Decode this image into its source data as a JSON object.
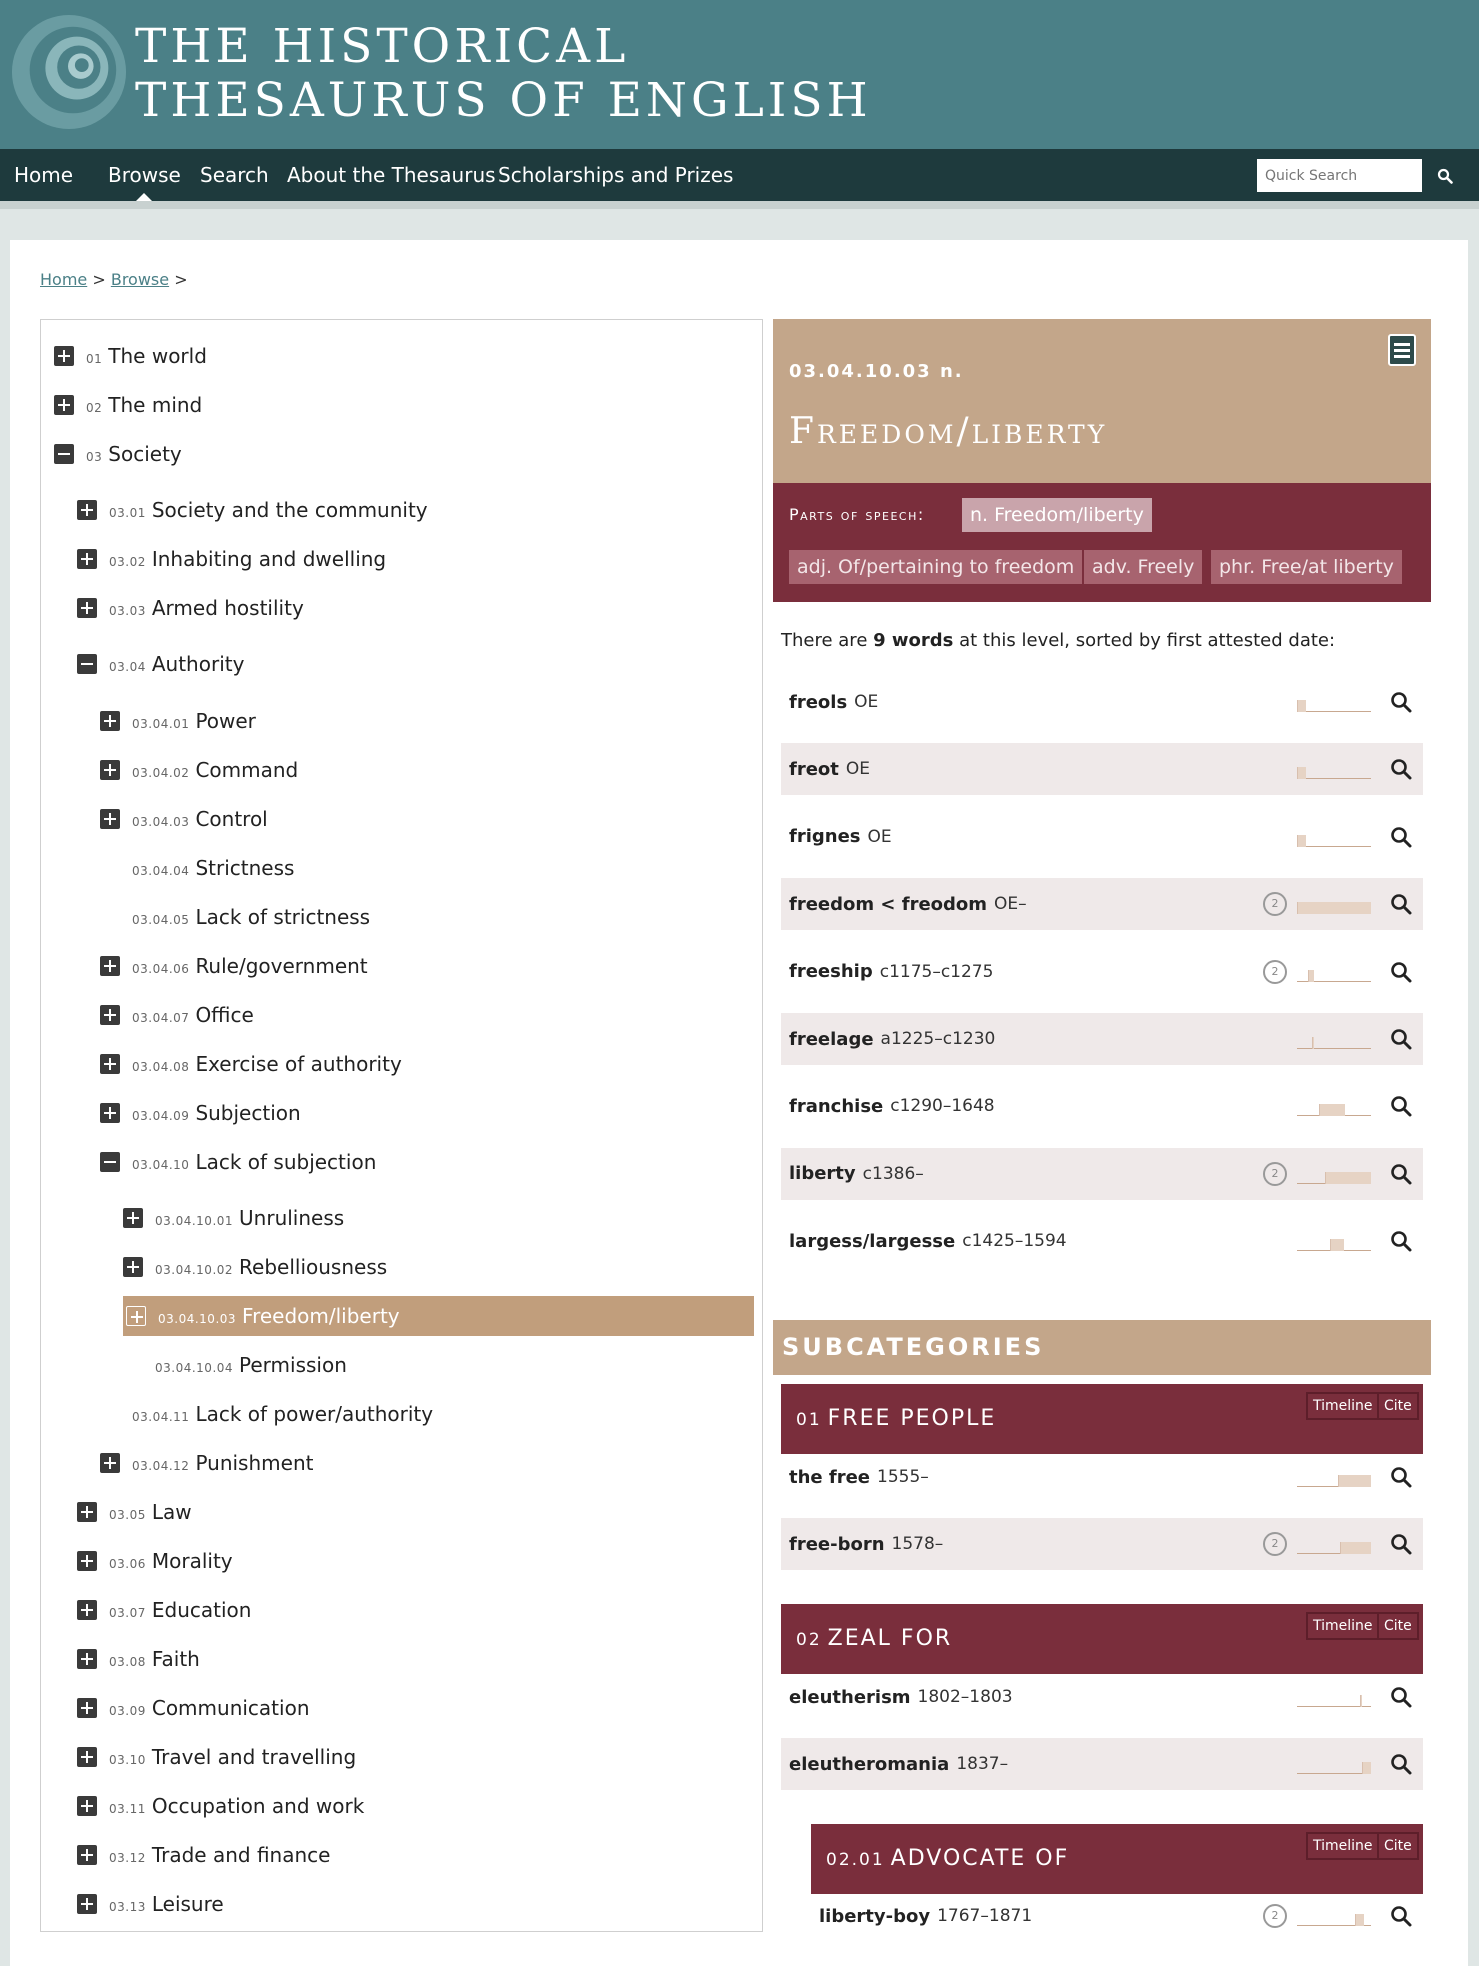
{
  "site": {
    "title_line1": "THE HISTORICAL",
    "title_line2": "THESAURUS OF ENGLISH"
  },
  "nav": {
    "items": [
      "Home",
      "Browse",
      "Search",
      "About the Thesaurus",
      "Scholarships and Prizes"
    ],
    "active": "Browse",
    "search_placeholder": "Quick Search"
  },
  "breadcrumb": {
    "home": "Home",
    "browse": "Browse",
    "sep": ">"
  },
  "tree": [
    {
      "code": "01",
      "label": "The world",
      "toggle": "plus"
    },
    {
      "code": "02",
      "label": "The mind",
      "toggle": "plus"
    },
    {
      "code": "03",
      "label": "Society",
      "toggle": "minus"
    },
    {
      "code": "03.01",
      "label": "Society and the community",
      "toggle": "plus"
    },
    {
      "code": "03.02",
      "label": "Inhabiting and dwelling",
      "toggle": "plus"
    },
    {
      "code": "03.03",
      "label": "Armed hostility",
      "toggle": "plus"
    },
    {
      "code": "03.04",
      "label": "Authority",
      "toggle": "minus"
    },
    {
      "code": "03.04.01",
      "label": "Power",
      "toggle": "plus"
    },
    {
      "code": "03.04.02",
      "label": "Command",
      "toggle": "plus"
    },
    {
      "code": "03.04.03",
      "label": "Control",
      "toggle": "plus"
    },
    {
      "code": "03.04.04",
      "label": "Strictness",
      "toggle": "none"
    },
    {
      "code": "03.04.05",
      "label": "Lack of strictness",
      "toggle": "none"
    },
    {
      "code": "03.04.06",
      "label": "Rule/government",
      "toggle": "plus"
    },
    {
      "code": "03.04.07",
      "label": "Office",
      "toggle": "plus"
    },
    {
      "code": "03.04.08",
      "label": "Exercise of authority",
      "toggle": "plus"
    },
    {
      "code": "03.04.09",
      "label": "Subjection",
      "toggle": "plus"
    },
    {
      "code": "03.04.10",
      "label": "Lack of subjection",
      "toggle": "minus"
    },
    {
      "code": "03.04.10.01",
      "label": "Unruliness",
      "toggle": "plus"
    },
    {
      "code": "03.04.10.02",
      "label": "Rebelliousness",
      "toggle": "plus"
    },
    {
      "code": "03.04.10.03",
      "label": "Freedom/liberty",
      "toggle": "plus",
      "selected": true
    },
    {
      "code": "03.04.10.04",
      "label": "Permission",
      "toggle": "none"
    },
    {
      "code": "03.04.11",
      "label": "Lack of power/authority",
      "toggle": "none"
    },
    {
      "code": "03.04.12",
      "label": "Punishment",
      "toggle": "plus"
    },
    {
      "code": "03.05",
      "label": "Law",
      "toggle": "plus"
    },
    {
      "code": "03.06",
      "label": "Morality",
      "toggle": "plus"
    },
    {
      "code": "03.07",
      "label": "Education",
      "toggle": "plus"
    },
    {
      "code": "03.08",
      "label": "Faith",
      "toggle": "plus"
    },
    {
      "code": "03.09",
      "label": "Communication",
      "toggle": "plus"
    },
    {
      "code": "03.10",
      "label": "Travel and travelling",
      "toggle": "plus"
    },
    {
      "code": "03.11",
      "label": "Occupation and work",
      "toggle": "plus"
    },
    {
      "code": "03.12",
      "label": "Trade and finance",
      "toggle": "plus"
    },
    {
      "code": "03.13",
      "label": "Leisure",
      "toggle": "plus"
    }
  ],
  "category": {
    "code": "03.04.10.03 n.",
    "title": "Freedom/liberty",
    "pos_label": "Parts of speech:",
    "pos_tags": [
      {
        "label": "n. Freedom/liberty",
        "active": true
      },
      {
        "label": "adj. Of/pertaining to freedom",
        "active": false
      },
      {
        "label": "adv. Freely",
        "active": false
      },
      {
        "label": "phr. Free/at liberty",
        "active": false
      }
    ],
    "intro_pre": "There are",
    "intro_count": "9 words",
    "intro_post": "at this level, sorted by first attested date:"
  },
  "words": [
    {
      "word": "freols",
      "date": "OE",
      "count": null,
      "bars": [
        [
          0,
          0.12
        ]
      ]
    },
    {
      "word": "freot",
      "date": "OE",
      "count": null,
      "bars": [
        [
          0,
          0.12
        ]
      ]
    },
    {
      "word": "frignes",
      "date": "OE",
      "count": null,
      "bars": [
        [
          0,
          0.12
        ]
      ]
    },
    {
      "word": "freedom < freodom",
      "date": "OE–",
      "count": "2",
      "bars": [
        [
          0,
          1.0
        ]
      ]
    },
    {
      "word": "freeship",
      "date": "c1175–c1275",
      "count": "2",
      "bars": [
        [
          0.15,
          0.08
        ]
      ]
    },
    {
      "word": "freelage",
      "date": "a1225–c1230",
      "count": null,
      "bars": [
        [
          0.2,
          0.02
        ]
      ]
    },
    {
      "word": "franchise",
      "date": "c1290–1648",
      "count": null,
      "bars": [
        [
          0.3,
          0.35
        ]
      ]
    },
    {
      "word": "liberty",
      "date": "c1386–",
      "count": "2",
      "bars": [
        [
          0.38,
          0.62
        ]
      ]
    },
    {
      "word": "largess/largesse",
      "date": "c1425–1594",
      "count": null,
      "bars": [
        [
          0.45,
          0.18
        ]
      ]
    }
  ],
  "subcategories": {
    "heading": "SUBCATEGORIES",
    "blocks": [
      {
        "num": "01",
        "title": "FREE PEOPLE",
        "timeline": "Timeline",
        "cite": "Cite",
        "words": [
          {
            "word": "the free",
            "date": "1555–",
            "count": null,
            "bars": [
              [
                0.55,
                0.45
              ]
            ]
          },
          {
            "word": "free-born",
            "date": "1578–",
            "count": "2",
            "bars": [
              [
                0.58,
                0.42
              ]
            ]
          }
        ]
      },
      {
        "num": "02",
        "title": "ZEAL FOR",
        "timeline": "Timeline",
        "cite": "Cite",
        "words": [
          {
            "word": "eleutherism",
            "date": "1802–1803",
            "count": null,
            "bars": [
              [
                0.85,
                0.01
              ]
            ]
          },
          {
            "word": "eleutheromania",
            "date": "1837–",
            "count": null,
            "bars": [
              [
                0.88,
                0.12
              ]
            ]
          }
        ]
      },
      {
        "num": "02.01",
        "title": "ADVOCATE OF",
        "timeline": "Timeline",
        "cite": "Cite",
        "words": [
          {
            "word": "liberty-boy",
            "date": "1767–1871",
            "count": "2",
            "bars": [
              [
                0.78,
                0.12
              ]
            ]
          }
        ]
      }
    ]
  },
  "colors": {
    "header": "#4b8087",
    "nav": "#1e3a3d",
    "tan": "#c3a68a",
    "maroon": "#7a2e3c",
    "row_alt": "#efe9e9"
  }
}
